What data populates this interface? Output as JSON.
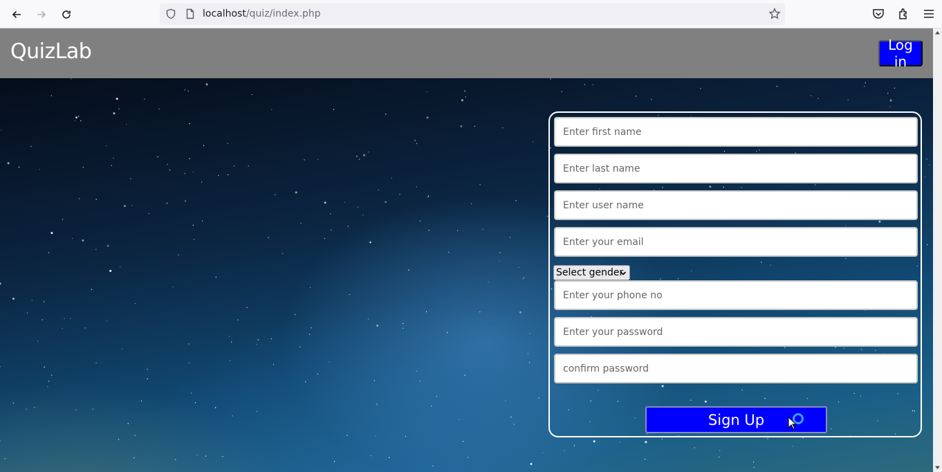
{
  "browser": {
    "url_host": "localhost",
    "url_path": "/quiz/index.php"
  },
  "header": {
    "brand": "QuizLab",
    "login_label": "Log in"
  },
  "form": {
    "first_name_placeholder": "Enter first name",
    "last_name_placeholder": "Enter last name",
    "user_name_placeholder": "Enter user name",
    "email_placeholder": "Enter your email",
    "gender_selected": "Select gender",
    "phone_placeholder": "Enter your phone no",
    "password_placeholder": "Enter your password",
    "confirm_placeholder": "confirm password",
    "signup_label": "Sign Up"
  },
  "colors": {
    "header_bg": "#808080",
    "accent": "#0000ff"
  },
  "icons": [
    "back-icon",
    "forward-icon",
    "reload-icon",
    "shield-icon",
    "page-icon",
    "star-icon",
    "pocket-icon",
    "extensions-icon",
    "menu-icon",
    "chevron-down-icon"
  ]
}
